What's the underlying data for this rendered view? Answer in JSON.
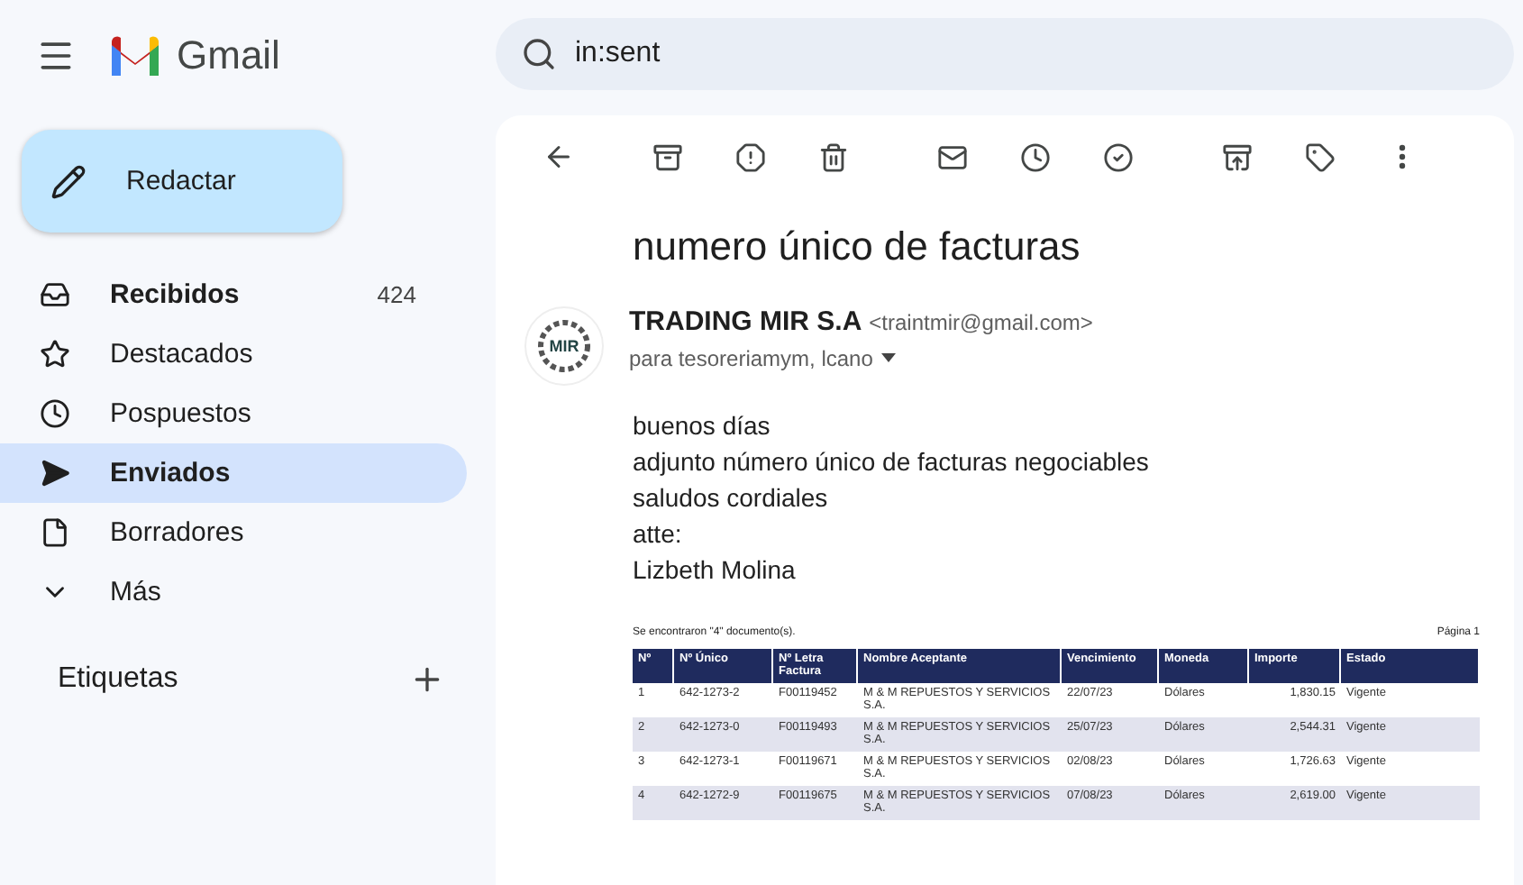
{
  "app": {
    "name": "Gmail"
  },
  "search": {
    "value": "in:sent"
  },
  "compose": {
    "label": "Redactar"
  },
  "sidebar": {
    "items": [
      {
        "kind": "inbox",
        "label": "Recibidos",
        "count": "424",
        "unread": true,
        "selected": false
      },
      {
        "kind": "starred",
        "label": "Destacados",
        "unread": false,
        "selected": false
      },
      {
        "kind": "snoozed",
        "label": "Pospuestos",
        "unread": false,
        "selected": false
      },
      {
        "kind": "sent",
        "label": "Enviados",
        "unread": false,
        "selected": true
      },
      {
        "kind": "drafts",
        "label": "Borradores",
        "unread": false,
        "selected": false
      },
      {
        "kind": "more",
        "label": "Más",
        "unread": false,
        "selected": false
      }
    ],
    "labels_heading": "Etiquetas"
  },
  "message": {
    "subject": "numero único de facturas",
    "sender_logo": "MIR",
    "sender_name": "TRADING MIR S.A",
    "sender_email": "<traintmir@gmail.com>",
    "recipients": "para tesoreriamym, lcano",
    "body": [
      "buenos días",
      "adjunto número único de facturas negociables",
      "saludos cordiales",
      "atte:",
      "Lizbeth Molina"
    ],
    "document": {
      "summary": "Se encontraron \"4\" documento(s).",
      "page": "Página 1",
      "columns": [
        "Nº",
        "Nº Único",
        "Nº Letra Factura",
        "Nombre Aceptante",
        "Vencimiento",
        "Moneda",
        "Importe",
        "Estado"
      ],
      "rows": [
        [
          "1",
          "642-1273-2",
          "F00119452",
          "M & M REPUESTOS Y SERVICIOS S.A.",
          "22/07/23",
          "Dólares",
          "1,830.15",
          "Vigente"
        ],
        [
          "2",
          "642-1273-0",
          "F00119493",
          "M & M REPUESTOS Y SERVICIOS S.A.",
          "25/07/23",
          "Dólares",
          "2,544.31",
          "Vigente"
        ],
        [
          "3",
          "642-1273-1",
          "F00119671",
          "M & M REPUESTOS Y SERVICIOS S.A.",
          "02/08/23",
          "Dólares",
          "1,726.63",
          "Vigente"
        ],
        [
          "4",
          "642-1272-9",
          "F00119675",
          "M & M REPUESTOS Y SERVICIOS S.A.",
          "07/08/23",
          "Dólares",
          "2,619.00",
          "Vigente"
        ]
      ]
    }
  }
}
